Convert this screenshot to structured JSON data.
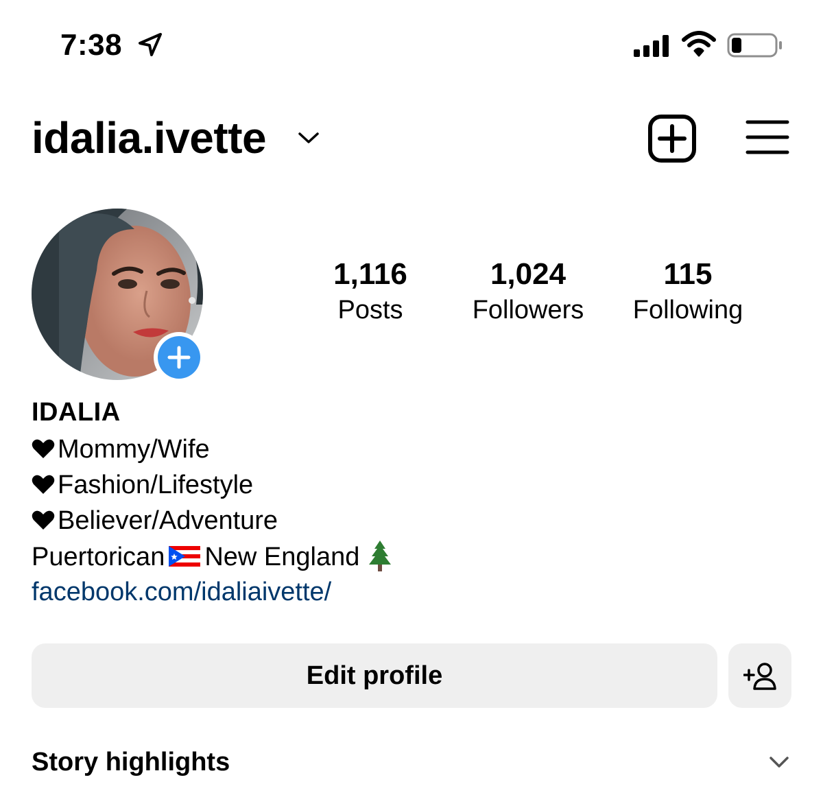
{
  "status_bar": {
    "time": "7:38",
    "location_icon": "location-arrow-icon",
    "signal_icon": "cellular-signal-icon",
    "wifi_icon": "wifi-icon",
    "battery_icon": "battery-low-icon"
  },
  "header": {
    "username": "idalia.ivette",
    "dropdown_icon": "chevron-down-icon",
    "new_post_icon": "plus-square-icon",
    "menu_icon": "hamburger-menu-icon"
  },
  "profile": {
    "avatar_icon": "profile-photo",
    "add_story_icon": "plus-icon",
    "add_story_color": "#3897f0",
    "stats": {
      "posts": {
        "value": "1,116",
        "label": "Posts"
      },
      "followers": {
        "value": "1,024",
        "label": "Followers"
      },
      "following": {
        "value": "115",
        "label": "Following"
      }
    },
    "display_name": "IDALIA",
    "bio": {
      "line1": "Mommy/Wife",
      "line2": "Fashion/Lifestyle",
      "line3": "Believer/Adventure",
      "line4_part1": "Puertorican",
      "line4_part2": "New England",
      "heart_icon": "black-heart-icon",
      "flag_icon": "puerto-rico-flag-icon",
      "tree_icon": "evergreen-tree-icon"
    },
    "link": "facebook.com/idaliaivette/",
    "link_color": "#00376b"
  },
  "actions": {
    "edit_profile_label": "Edit profile",
    "discover_people_icon": "add-person-icon"
  },
  "highlights": {
    "title": "Story highlights",
    "chevron_icon": "chevron-down-icon"
  }
}
